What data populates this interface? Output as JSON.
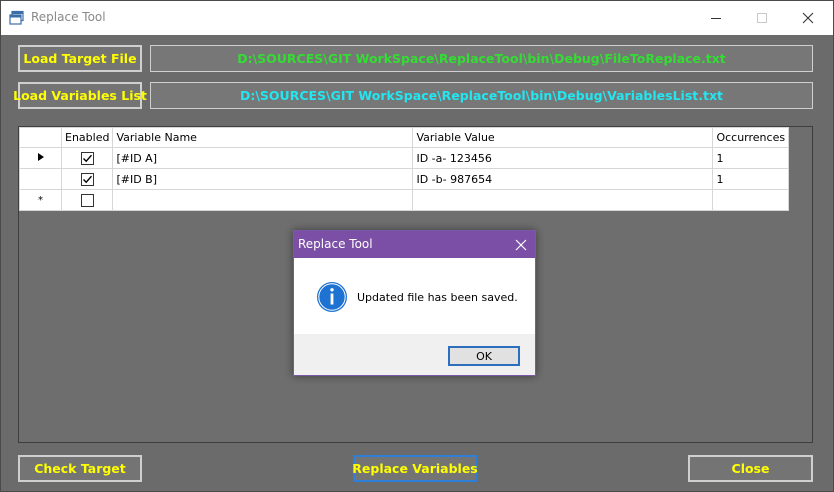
{
  "window": {
    "title": "Replace Tool"
  },
  "top": {
    "load_target_label": "Load Target File",
    "target_path": "D:\\SOURCES\\GIT WorkSpace\\ReplaceTool\\bin\\Debug\\FileToReplace.txt",
    "load_variables_label": "Load Variables List",
    "variables_path": "D:\\SOURCES\\GIT WorkSpace\\ReplaceTool\\bin\\Debug\\VariablesList.txt"
  },
  "grid": {
    "columns": [
      "Enabled",
      "Variable Name",
      "Variable Value",
      "Occurrences"
    ],
    "rows": [
      {
        "enabled": true,
        "name": "[#ID A]",
        "value": "ID -a- 123456",
        "occurrences": "1"
      },
      {
        "enabled": true,
        "name": "[#ID B]",
        "value": "ID -b- 987654",
        "occurrences": "1"
      }
    ],
    "new_row_marker": "*"
  },
  "bottom": {
    "check_target_label": "Check Target",
    "replace_label": "Replace Variables",
    "close_label": "Close"
  },
  "dialog": {
    "title": "Replace Tool",
    "message": "Updated file has been saved.",
    "ok_label": "OK",
    "icon": "info-icon"
  },
  "colors": {
    "button_text": "#ffff00",
    "target_path_text": "#33dd33",
    "variables_path_text": "#22e6f0",
    "dialog_title_bar": "#7b4fa6",
    "info_icon": "#1e73d2"
  }
}
